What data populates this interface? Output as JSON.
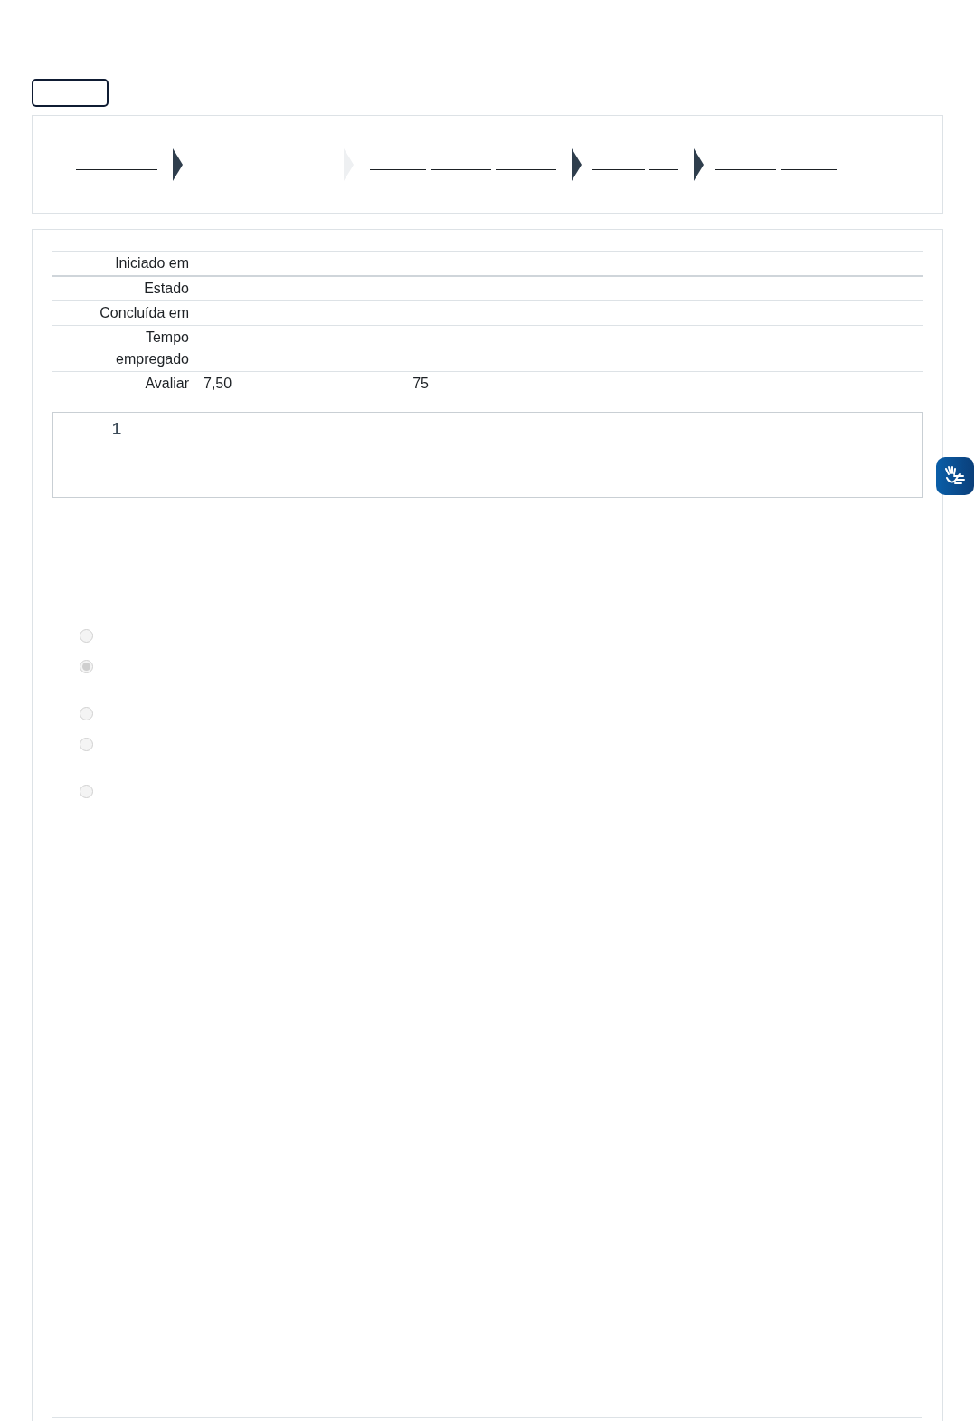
{
  "breadcrumb": [
    {
      "kind": "link"
    },
    {
      "kind": "blank"
    },
    {
      "kind": "link"
    },
    {
      "kind": "link"
    },
    {
      "kind": "link"
    }
  ],
  "separators": [
    {
      "faint": false
    },
    {
      "faint": true
    },
    {
      "faint": false
    },
    {
      "faint": false
    }
  ],
  "summary": [
    {
      "label": "Iniciado em"
    },
    {
      "label": "Estado"
    },
    {
      "label": "Concluída em"
    },
    {
      "label": "Tempo empregado"
    },
    {
      "label": "Avaliar",
      "value": "7,50",
      "extra": "75"
    }
  ],
  "question": {
    "number": "1"
  },
  "options": [
    {
      "selected": false
    },
    {
      "selected": true
    },
    {
      "selected": false
    },
    {
      "selected": false
    },
    {
      "selected": false
    }
  ]
}
